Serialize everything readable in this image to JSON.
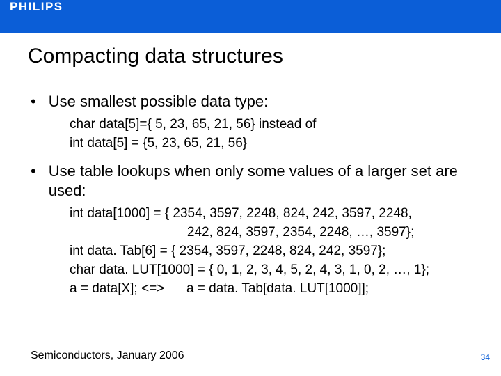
{
  "brand": "PHILIPS",
  "title": "Compacting data structures",
  "bullets": {
    "b1": "Use smallest possible data type:",
    "b1_sub1": "char data[5]={ 5, 23, 65, 21, 56} instead of",
    "b1_sub2": "int data[5] = {5, 23, 65, 21, 56}",
    "b2": "Use table lookups when only some values of a larger set are used:",
    "b2_sub1": "int data[1000] = { 2354, 3597, 2248, 824, 242, 3597, 2248,",
    "b2_sub2": "                                242, 824, 3597, 2354, 2248, …, 3597};",
    "b2_sub3": "int data. Tab[6] = { 2354, 3597, 2248, 824, 242, 3597};",
    "b2_sub4": "char data. LUT[1000] = { 0, 1, 2, 3, 4, 5, 2, 4, 3, 1, 0, 2, …, 1};",
    "b2_sub5": "a = data[X]; <=>      a = data. Tab[data. LUT[1000]];"
  },
  "footer": "Semiconductors, January 2006",
  "page": "34"
}
